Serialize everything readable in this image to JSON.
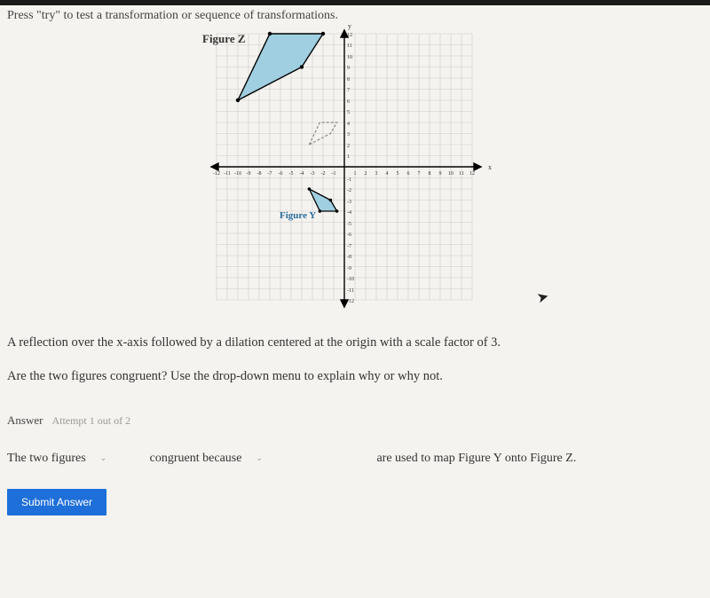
{
  "instruction": "Press \"try\" to test a transformation or sequence of transformations.",
  "figureZ": "Figure Z",
  "figureY": "Figure Y",
  "axes": {
    "x": "x",
    "y": "y"
  },
  "description": "A reflection over the x-axis followed by a dilation centered at the origin with a scale factor of 3.",
  "question": "Are the two figures congruent? Use the drop-down menu to explain why or why not.",
  "answerLabel": "Answer",
  "attemptLabel": "Attempt 1 out of 2",
  "sentence": {
    "part1": "The two figures",
    "part2": "congruent because",
    "part3": "are used to map Figure Y onto Figure Z."
  },
  "submit": "Submit Answer",
  "chart_data": {
    "type": "scatter",
    "title": "",
    "xlabel": "x",
    "ylabel": "y",
    "xlim": [
      -12,
      12
    ],
    "ylim": [
      -12,
      12
    ],
    "xticks": [
      -12,
      -11,
      -10,
      -9,
      -8,
      -7,
      -6,
      -5,
      -4,
      -3,
      -2,
      -1,
      1,
      2,
      3,
      4,
      5,
      6,
      7,
      8,
      9,
      10,
      11,
      12
    ],
    "yticks": [
      -12,
      -11,
      -10,
      -9,
      -8,
      -7,
      -6,
      -5,
      -4,
      -3,
      -2,
      -1,
      1,
      2,
      3,
      4,
      5,
      6,
      7,
      8,
      9,
      10,
      11,
      12
    ],
    "shapes": [
      {
        "name": "Figure Z",
        "fill": "#9fcfe0",
        "stroke": "#000",
        "points": [
          [
            -10,
            6
          ],
          [
            -7,
            12
          ],
          [
            -2,
            12
          ],
          [
            -4,
            9
          ]
        ]
      },
      {
        "name": "Figure Y",
        "fill": "#9fcfe0",
        "stroke": "#000",
        "points": [
          [
            -3.3,
            -2
          ],
          [
            -2.3,
            -4
          ],
          [
            -0.7,
            -4
          ],
          [
            -1.3,
            -3
          ]
        ]
      },
      {
        "name": "Dashed preview",
        "fill": "none",
        "stroke": "#888",
        "dashed": true,
        "points": [
          [
            -3.3,
            2
          ],
          [
            -2.3,
            4
          ],
          [
            -0.7,
            4
          ],
          [
            -1.3,
            3
          ]
        ]
      }
    ]
  }
}
